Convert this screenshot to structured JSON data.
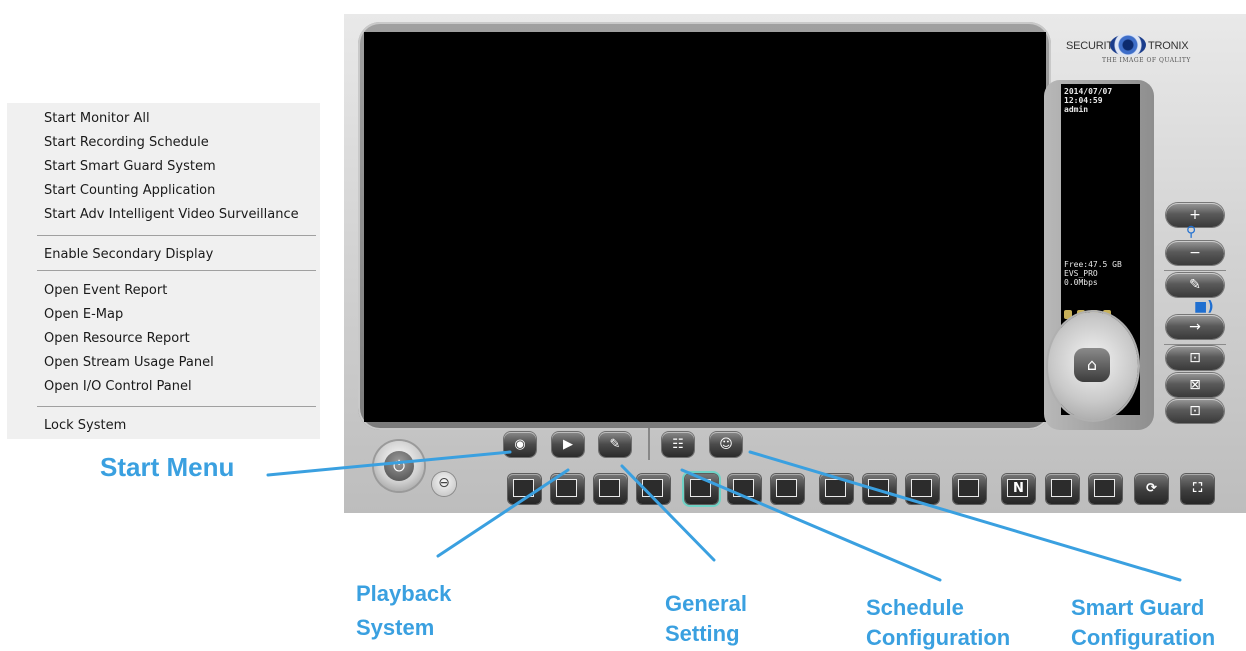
{
  "menu": {
    "items": [
      {
        "label": "Start Monitor All"
      },
      {
        "label": "Start Recording Schedule"
      },
      {
        "label": "Start Smart Guard System"
      },
      {
        "label": "Start Counting Application"
      },
      {
        "label": "Start Adv Intelligent Video Surveillance"
      },
      {
        "label": "Enable Secondary Display"
      },
      {
        "label": "Open Event Report"
      },
      {
        "label": "Open E-Map"
      },
      {
        "label": "Open Resource Report"
      },
      {
        "label": "Open Stream Usage Panel"
      },
      {
        "label": "Open I/O Control Panel"
      },
      {
        "label": "Lock System"
      }
    ]
  },
  "callouts": {
    "start_menu": "Start Menu",
    "playback_line1": "Playback",
    "playback_line2": "System",
    "general_line1": "General",
    "general_line2": "Setting",
    "schedule_line1": "Schedule",
    "schedule_line2": "Configuration",
    "smartguard_line1": "Smart Guard",
    "smartguard_line2": "Configuration"
  },
  "brand": {
    "name_left": "SECURITY",
    "name_right": "TRONIX",
    "tagline": "THE IMAGE OF QUALITY"
  },
  "info_panel": {
    "date": "2014/07/07",
    "time": "12:04:59",
    "user": "admin",
    "free_space": "Free:47.5 GB",
    "edition": "EVS_PRO",
    "bandwidth": "0.0Mbps"
  },
  "icons": {
    "power": "power-icon",
    "minus": "minus-icon",
    "start": "record-circle-icon",
    "playback": "play-icon",
    "settings": "wrench-icon",
    "schedule": "schedule-icon",
    "smartguard": "smart-guard-icon",
    "home": "home-icon",
    "zoom_in": "plus-icon",
    "zoom": "magnifier-icon",
    "zoom_out": "minus-icon"
  },
  "layout_buttons": {
    "n_label": "N"
  },
  "colors": {
    "callout": "#3aa0e0",
    "accent_selected": "#6fd3c6"
  }
}
